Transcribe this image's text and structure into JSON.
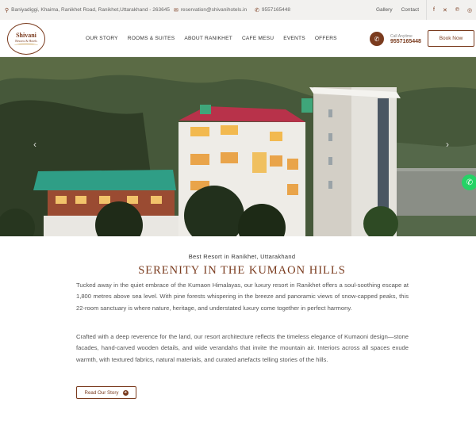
{
  "topbar": {
    "address": "Baniyadiggi, Khaima, Ranikhet Road, Ranikhet,Uttarakhand - 263645",
    "email": "reservation@shivanihotels.in",
    "phone": "9557165448",
    "links": [
      "Gallery",
      "Contact"
    ],
    "social_icons": [
      "facebook-icon",
      "x-icon",
      "pinterest-icon",
      "instagram-icon"
    ]
  },
  "header": {
    "logo_name": "Shivani",
    "logo_tagline": "Resorts & Hotels",
    "nav": [
      "OUR STORY",
      "ROOMS & SUITES",
      "ABOUT RANIKHET",
      "CAFE MESU",
      "EVENTS",
      "OFFERS"
    ],
    "call_label": "Call Anytime",
    "call_number": "9557165448",
    "book_label": "Book Now"
  },
  "hero": {
    "prev_arrow": "‹",
    "next_arrow": "›"
  },
  "content": {
    "subtitle": "Best Resort in Ranikhet, Uttarakhand",
    "title": "SERENITY IN THE KUMAON HILLS",
    "paragraph1": "Tucked away in the quiet embrace of the Kumaon Himalayas, our luxury resort in Ranikhet offers a soul-soothing escape at 1,800 metres above sea level. With pine forests whispering in the breeze and panoramic views of snow-capped peaks, this 22-room sanctuary is where nature, heritage, and understated luxury come together in perfect harmony.",
    "paragraph2": "Crafted with a deep reverence for the land, our resort architecture reflects the timeless elegance of Kumaoni design—stone facades, hand-carved wooden details, and wide verandahs that invite the mountain air. Interiors across all spaces exude warmth, with textured fabrics, natural materials, and curated artefacts telling stories of the hills.",
    "button_label": "Read Our Story"
  },
  "colors": {
    "accent": "#7a3b1e",
    "whatsapp": "#25d366",
    "topbar_bg": "#f2f1ef"
  }
}
